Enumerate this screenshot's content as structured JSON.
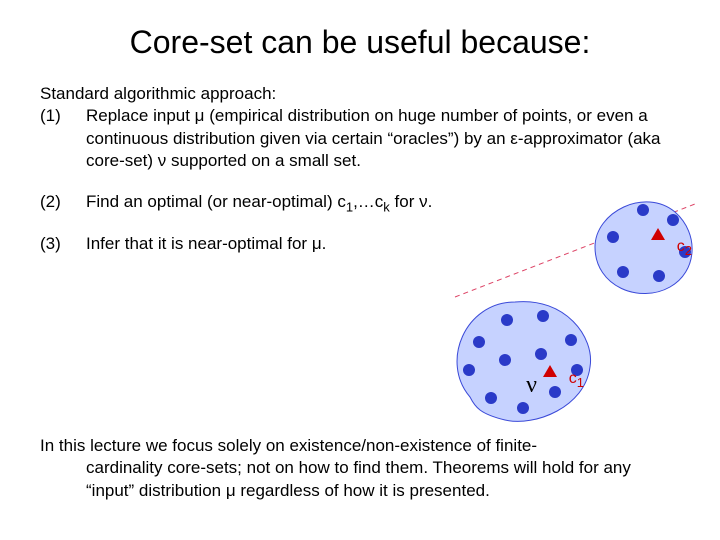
{
  "title": "Core-set can be useful because:",
  "intro": "Standard algorithmic approach:",
  "items": [
    {
      "n": "(1)",
      "t": "Replace input μ (empirical distribution on huge number of points, or even a continuous distribution given via certain “oracles”) by an ε-approximator (aka core-set) ν supported on a small set."
    },
    {
      "n": "(2)",
      "t": "Find an optimal (or near-optimal) c₁,…c_k for ν."
    },
    {
      "n": "(3)",
      "t": "Infer that it is near-optimal for μ."
    }
  ],
  "centers": {
    "c1": "c",
    "c1s": "1",
    "c2": "c",
    "c2s": "2"
  },
  "nu": "ν",
  "closing_lead": "In this lecture we focus solely on existence/non-existence of finite-",
  "closing_rest": "cardinality core-sets; not on how to find them. Theorems will hold for any “input” distribution μ regardless of how it is presented."
}
